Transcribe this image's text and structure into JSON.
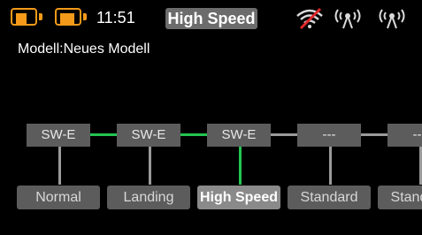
{
  "status": {
    "time": "11:51",
    "flight_mode": "High Speed",
    "battery_color": "#f39a1a",
    "icons": [
      "battery-icon",
      "battery-icon",
      "wifi-off-icon",
      "antenna-signal-icon",
      "antenna-signal-icon"
    ]
  },
  "model": {
    "label": "Modell:Neues Modell"
  },
  "switches": [
    {
      "label": "SW-E"
    },
    {
      "label": "SW-E"
    },
    {
      "label": "SW-E"
    },
    {
      "label": "---"
    },
    {
      "label": "---"
    }
  ],
  "connectors": {
    "active_color": "#23c552",
    "inactive_color": "#9a9a9a",
    "horizontal_states": [
      "active",
      "active",
      "inactive",
      "inactive"
    ],
    "vertical_states": [
      "inactive",
      "inactive",
      "active",
      "inactive",
      "inactive"
    ]
  },
  "phases": [
    {
      "label": "Normal",
      "active": false
    },
    {
      "label": "Landing",
      "active": false
    },
    {
      "label": "High Speed",
      "active": true
    },
    {
      "label": "Standard",
      "active": false
    },
    {
      "label": "Standard",
      "active": false
    }
  ]
}
